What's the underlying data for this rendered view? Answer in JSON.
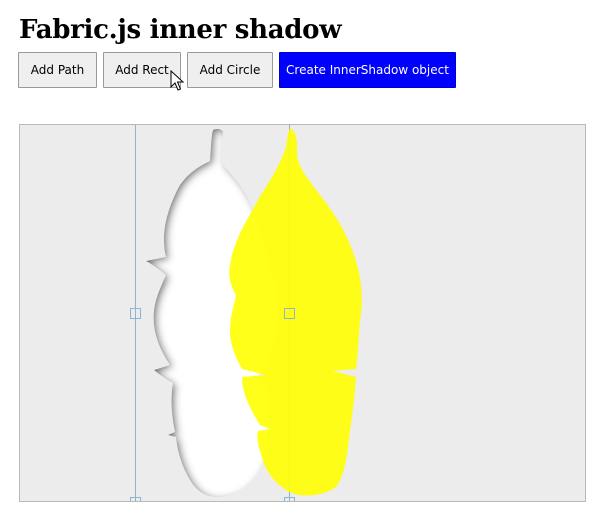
{
  "page": {
    "title": "Fabric.js inner shadow"
  },
  "toolbar": {
    "buttons": [
      {
        "label": "Add Path"
      },
      {
        "label": "Add Rect"
      },
      {
        "label": "Add Circle"
      },
      {
        "label": "Create InnerShadow object"
      }
    ]
  },
  "canvas": {
    "background": "#ececed",
    "objects": [
      {
        "kind": "leaf-path",
        "fill": "#ffffff",
        "effect": "inner-shadow",
        "selected": true
      },
      {
        "kind": "leaf-path",
        "fill": "#ffff00",
        "opacity": 0.9
      }
    ]
  },
  "colors": {
    "accent": "#0000ff",
    "leaf_yellow": "#ffff00",
    "selection": "#8fb4d0"
  },
  "icons": {
    "cursor": "mouse-pointer-icon"
  }
}
